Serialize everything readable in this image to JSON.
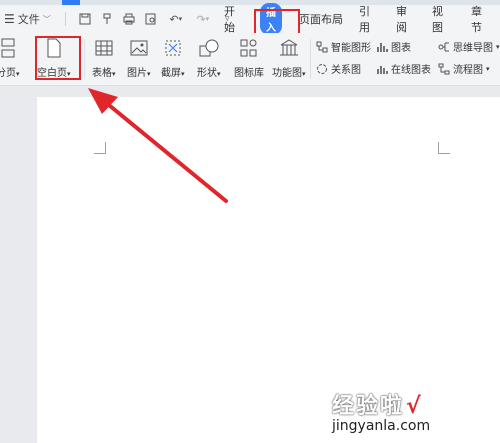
{
  "menu": {
    "file_label": "文件",
    "tabs": [
      "开始",
      "插入",
      "页面布局",
      "引用",
      "审阅",
      "视图",
      "章节"
    ],
    "active_tab": "插入"
  },
  "ribbon": {
    "page_break": "分页",
    "blank_page": "空白页",
    "table": "表格",
    "picture": "图片",
    "screenshot": "截屏",
    "shapes": "形状",
    "icon_library": "图标库",
    "function_chart": "功能图",
    "smart_art": "智能图形",
    "chart": "图表",
    "mind_map": "思维导图",
    "relation_chart": "关系图",
    "online_chart": "在线图表",
    "flowchart": "流程图"
  },
  "watermark": {
    "text": "经验啦",
    "check": "√",
    "url": "jingyanla.com"
  },
  "colors": {
    "accent": "#3b82f6",
    "highlight": "#e0262a"
  }
}
